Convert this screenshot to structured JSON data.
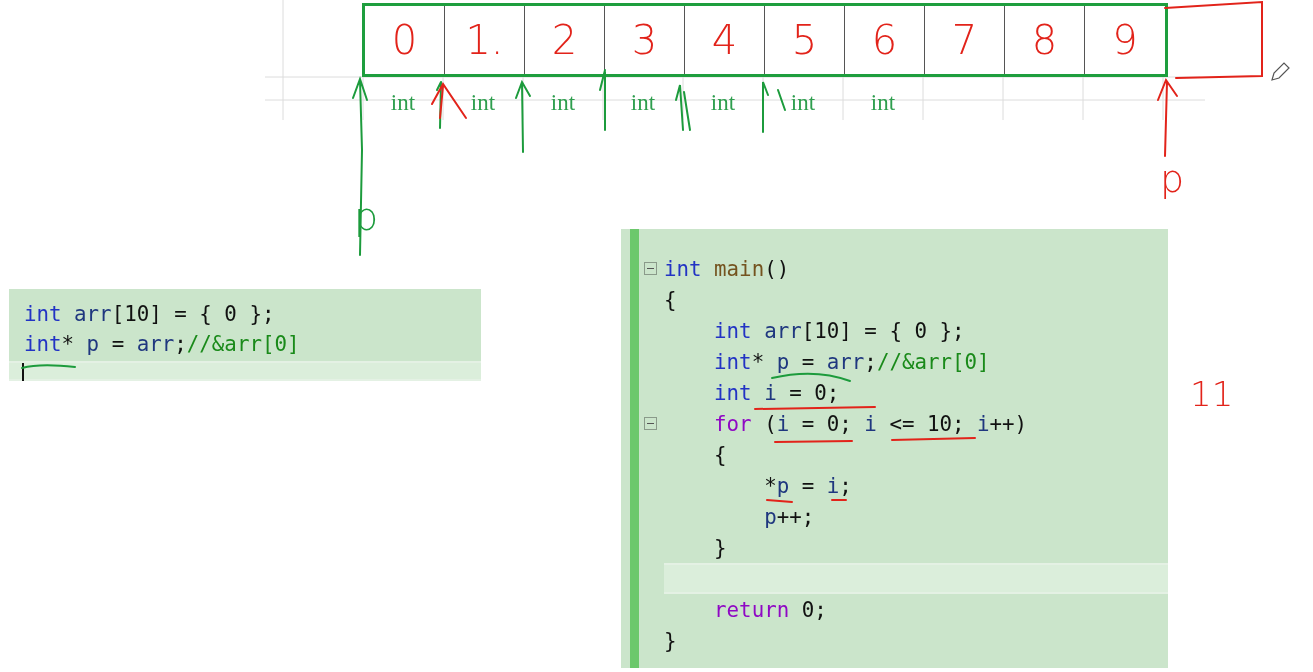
{
  "array_diagram": {
    "cells": [
      "0",
      "1.",
      "2",
      "3",
      "4",
      "5",
      "6",
      "7",
      "8",
      "9"
    ],
    "type_labels": [
      "int",
      "int",
      "int",
      "int",
      "int",
      "int",
      "int"
    ],
    "pointer_labels": [
      "p",
      "p"
    ]
  },
  "side_note": "11",
  "snippets": [
    {
      "lines": [
        {
          "collapsible": false,
          "current": false,
          "tokens": [
            {
              "kind": "keyword",
              "text": "int"
            },
            {
              "kind": "ident",
              "text": " arr"
            },
            {
              "kind": "plain",
              "text": "[10] = { 0 };"
            }
          ]
        },
        {
          "collapsible": false,
          "current": false,
          "tokens": [
            {
              "kind": "keyword",
              "text": "int"
            },
            {
              "kind": "plain",
              "text": "* "
            },
            {
              "kind": "ident",
              "text": "p"
            },
            {
              "kind": "plain",
              "text": " = "
            },
            {
              "kind": "ident",
              "text": "arr"
            },
            {
              "kind": "plain",
              "text": ";"
            },
            {
              "kind": "comment",
              "text": "//&arr[0]"
            }
          ]
        },
        {
          "collapsible": false,
          "current": true
        }
      ]
    },
    {
      "lines": [
        {
          "collapsible": true,
          "current": false,
          "tokens": [
            {
              "kind": "keyword",
              "text": "int"
            },
            {
              "kind": "function",
              "text": " main"
            },
            {
              "kind": "plain",
              "text": "()"
            }
          ]
        },
        {
          "collapsible": false,
          "current": false,
          "tokens": [
            {
              "kind": "plain",
              "text": "{"
            }
          ]
        },
        {
          "kind": "block",
          "children": [
            {
              "collapsible": false,
              "current": false,
              "tokens": [
                {
                  "kind": "keyword",
                  "text": "int"
                },
                {
                  "kind": "ident",
                  "text": " arr"
                },
                {
                  "kind": "plain",
                  "text": "[10] = { 0 };"
                }
              ]
            },
            {
              "collapsible": false,
              "current": false,
              "tokens": [
                {
                  "kind": "keyword",
                  "text": "int"
                },
                {
                  "kind": "plain",
                  "text": "* "
                },
                {
                  "kind": "ident",
                  "text": "p"
                },
                {
                  "kind": "plain",
                  "text": " = "
                },
                {
                  "kind": "ident",
                  "text": "arr"
                },
                {
                  "kind": "plain",
                  "text": ";"
                },
                {
                  "kind": "comment",
                  "text": "//&arr[0]"
                }
              ]
            },
            {
              "collapsible": false,
              "current": false,
              "tokens": [
                {
                  "kind": "keyword",
                  "text": "int"
                },
                {
                  "kind": "ident",
                  "text": " i"
                },
                {
                  "kind": "plain",
                  "text": " = 0;"
                }
              ]
            },
            {
              "collapsible": true,
              "current": false,
              "tokens": [
                {
                  "kind": "control",
                  "text": "for"
                },
                {
                  "kind": "plain",
                  "text": " ("
                },
                {
                  "kind": "ident",
                  "text": "i"
                },
                {
                  "kind": "plain",
                  "text": " = 0; "
                },
                {
                  "kind": "ident",
                  "text": "i"
                },
                {
                  "kind": "plain",
                  "text": " <= 10; "
                },
                {
                  "kind": "ident",
                  "text": "i"
                },
                {
                  "kind": "plain",
                  "text": "++)"
                }
              ]
            },
            {
              "collapsible": false,
              "current": false,
              "tokens": [
                {
                  "kind": "plain",
                  "text": "{"
                }
              ]
            },
            {
              "kind": "block",
              "children": [
                {
                  "collapsible": false,
                  "current": false,
                  "tokens": [
                    {
                      "kind": "plain",
                      "text": "*"
                    },
                    {
                      "kind": "ident",
                      "text": "p"
                    },
                    {
                      "kind": "plain",
                      "text": " = "
                    },
                    {
                      "kind": "ident",
                      "text": "i"
                    },
                    {
                      "kind": "plain",
                      "text": ";"
                    }
                  ]
                },
                {
                  "collapsible": false,
                  "current": false,
                  "tokens": [
                    {
                      "kind": "ident",
                      "text": "p"
                    },
                    {
                      "kind": "plain",
                      "text": "++;"
                    }
                  ]
                }
              ]
            },
            {
              "collapsible": false,
              "current": false,
              "tokens": [
                {
                  "kind": "plain",
                  "text": "}"
                }
              ]
            },
            {
              "collapsible": false,
              "current": true
            },
            {
              "collapsible": false,
              "current": false,
              "tokens": [
                {
                  "kind": "control",
                  "text": "return"
                },
                {
                  "kind": "plain",
                  "text": " 0;"
                }
              ]
            }
          ]
        },
        {
          "collapsible": false,
          "current": false,
          "tokens": [
            {
              "kind": "plain",
              "text": "}"
            }
          ]
        }
      ]
    }
  ]
}
